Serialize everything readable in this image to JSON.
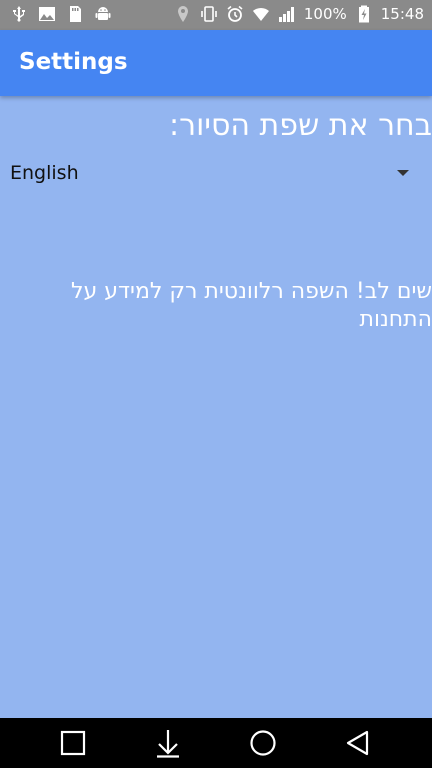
{
  "statusbar": {
    "left_icons": [
      "usb-icon",
      "image-icon",
      "sd-card-icon",
      "android-icon"
    ],
    "right_icons": [
      "location-icon",
      "vibrate-icon",
      "alarm-icon",
      "wifi-icon",
      "signal-icon",
      "battery-charging-icon"
    ],
    "battery": "100%",
    "time": "15:48"
  },
  "appbar": {
    "title": "Settings"
  },
  "main": {
    "prompt": "בחר את שפת הסיור:",
    "dropdown": {
      "selected": "English",
      "icon": "dropdown-arrow-icon"
    },
    "note": "שים לב! השפה רלוונטית רק למידע על התחנות"
  },
  "navbar": {
    "icons": [
      "recent-apps-icon",
      "download-icon",
      "home-icon",
      "back-icon"
    ]
  },
  "colors": {
    "background": "#93b5f0",
    "appbar": "#4585f2",
    "statusbar": "#8a8a8a",
    "navbar": "#000000"
  }
}
